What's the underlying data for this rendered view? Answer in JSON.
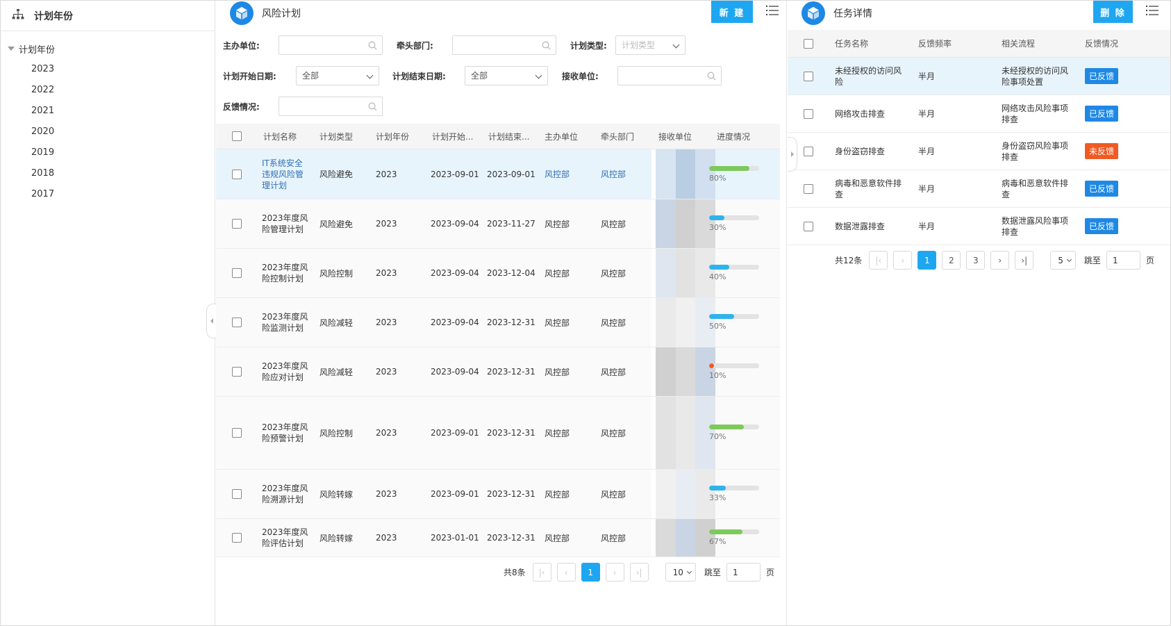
{
  "left": {
    "title": "计划年份",
    "root_label": "计划年份",
    "years": [
      "2023",
      "2022",
      "2021",
      "2020",
      "2019",
      "2018",
      "2017"
    ]
  },
  "plan": {
    "title": "风险计划",
    "new_label": "新 建",
    "filters": {
      "host_unit": {
        "label": "主办单位:",
        "value": ""
      },
      "lead_dept": {
        "label": "牵头部门:",
        "value": ""
      },
      "plan_type": {
        "label": "计划类型:",
        "placeholder": "计划类型"
      },
      "start_date": {
        "label": "计划开始日期:",
        "value": "全部"
      },
      "end_date": {
        "label": "计划结束日期:",
        "value": "全部"
      },
      "receiver": {
        "label": "接收单位:",
        "value": ""
      },
      "feedback": {
        "label": "反馈情况:",
        "value": ""
      }
    },
    "columns": [
      "计划名称",
      "计划类型",
      "计划年份",
      "计划开始...",
      "计划结束...",
      "主办单位",
      "牵头部门",
      "接收单位",
      "进度情况"
    ],
    "rows": [
      {
        "name": "IT系统安全违规风险管理计划",
        "type": "风险避免",
        "year": "2023",
        "start": "2023-09-01",
        "end": "2023-09-01",
        "host": "风控部",
        "lead": "风控部",
        "progress": 80,
        "progress_label": "80%",
        "color": "#7dc95b"
      },
      {
        "name": "2023年度风险管理计划",
        "type": "风险避免",
        "year": "2023",
        "start": "2023-09-04",
        "end": "2023-11-27",
        "host": "风控部",
        "lead": "风控部",
        "progress": 30,
        "progress_label": "30%",
        "color": "#2fb3ec"
      },
      {
        "name": "2023年度风险控制计划",
        "type": "风险控制",
        "year": "2023",
        "start": "2023-09-04",
        "end": "2023-12-04",
        "host": "风控部",
        "lead": "风控部",
        "progress": 40,
        "progress_label": "40%",
        "color": "#2fb3ec"
      },
      {
        "name": "2023年度风险监测计划",
        "type": "风险减轻",
        "year": "2023",
        "start": "2023-09-04",
        "end": "2023-12-31",
        "host": "风控部",
        "lead": "风控部",
        "progress": 50,
        "progress_label": "50%",
        "color": "#2fb3ec"
      },
      {
        "name": "2023年度风险应对计划",
        "type": "风险减轻",
        "year": "2023",
        "start": "2023-09-04",
        "end": "2023-12-31",
        "host": "风控部",
        "lead": "风控部",
        "progress": 10,
        "progress_label": "10%",
        "color": "#f05a23"
      },
      {
        "name": "2023年度风险预警计划",
        "type": "风险控制",
        "year": "2023",
        "start": "2023-09-01",
        "end": "2023-12-31",
        "host": "风控部",
        "lead": "风控部",
        "progress": 70,
        "progress_label": "70%",
        "color": "#7dc95b"
      },
      {
        "name": "2023年度风险溯源计划",
        "type": "风险转嫁",
        "year": "2023",
        "start": "2023-09-01",
        "end": "2023-12-31",
        "host": "风控部",
        "lead": "风控部",
        "progress": 33,
        "progress_label": "33%",
        "color": "#2fb3ec"
      },
      {
        "name": "2023年度风险评估计划",
        "type": "风险转嫁",
        "year": "2023",
        "start": "2023-01-01",
        "end": "2023-12-31",
        "host": "风控部",
        "lead": "风控部",
        "progress": 67,
        "progress_label": "67%",
        "color": "#7dc95b"
      }
    ],
    "pager": {
      "total": "共8条",
      "current": "1",
      "size": "10",
      "jump_label": "跳至",
      "jump_value": "1",
      "page_suffix": "页"
    }
  },
  "task": {
    "title": "任务详情",
    "delete_label": "删 除",
    "columns": [
      "任务名称",
      "反馈频率",
      "相关流程",
      "反馈情况"
    ],
    "rows": [
      {
        "name": "未经授权的访问风险",
        "freq": "半月",
        "flow": "未经授权的访问风险事项处置",
        "status": "已反馈",
        "color": "#1e88e5"
      },
      {
        "name": "网络攻击排查",
        "freq": "半月",
        "flow": "网络攻击风险事项排查",
        "status": "已反馈",
        "color": "#1e88e5"
      },
      {
        "name": "身份盗窃排查",
        "freq": "半月",
        "flow": "身份盗窃风险事项排查",
        "status": "未反馈",
        "color": "#f05a23"
      },
      {
        "name": "病毒和恶意软件排查",
        "freq": "半月",
        "flow": "病毒和恶意软件排查",
        "status": "已反馈",
        "color": "#1e88e5"
      },
      {
        "name": "数据泄露排查",
        "freq": "半月",
        "flow": "数据泄露风险事项排查",
        "status": "已反馈",
        "color": "#1e88e5"
      }
    ],
    "pager": {
      "total": "共12条",
      "pages": [
        "1",
        "2",
        "3"
      ],
      "current": "1",
      "size": "5",
      "jump_label": "跳至",
      "jump_value": "1",
      "page_suffix": "页"
    }
  },
  "colors": {
    "accent": "#1ea7f0",
    "selected_row": "#e8f4fc",
    "link": "#2f6fb3"
  },
  "icons": {
    "tree": "org-tree-icon",
    "logo": "cube-logo-icon",
    "menu": "list-menu-icon",
    "search": "search-icon"
  }
}
